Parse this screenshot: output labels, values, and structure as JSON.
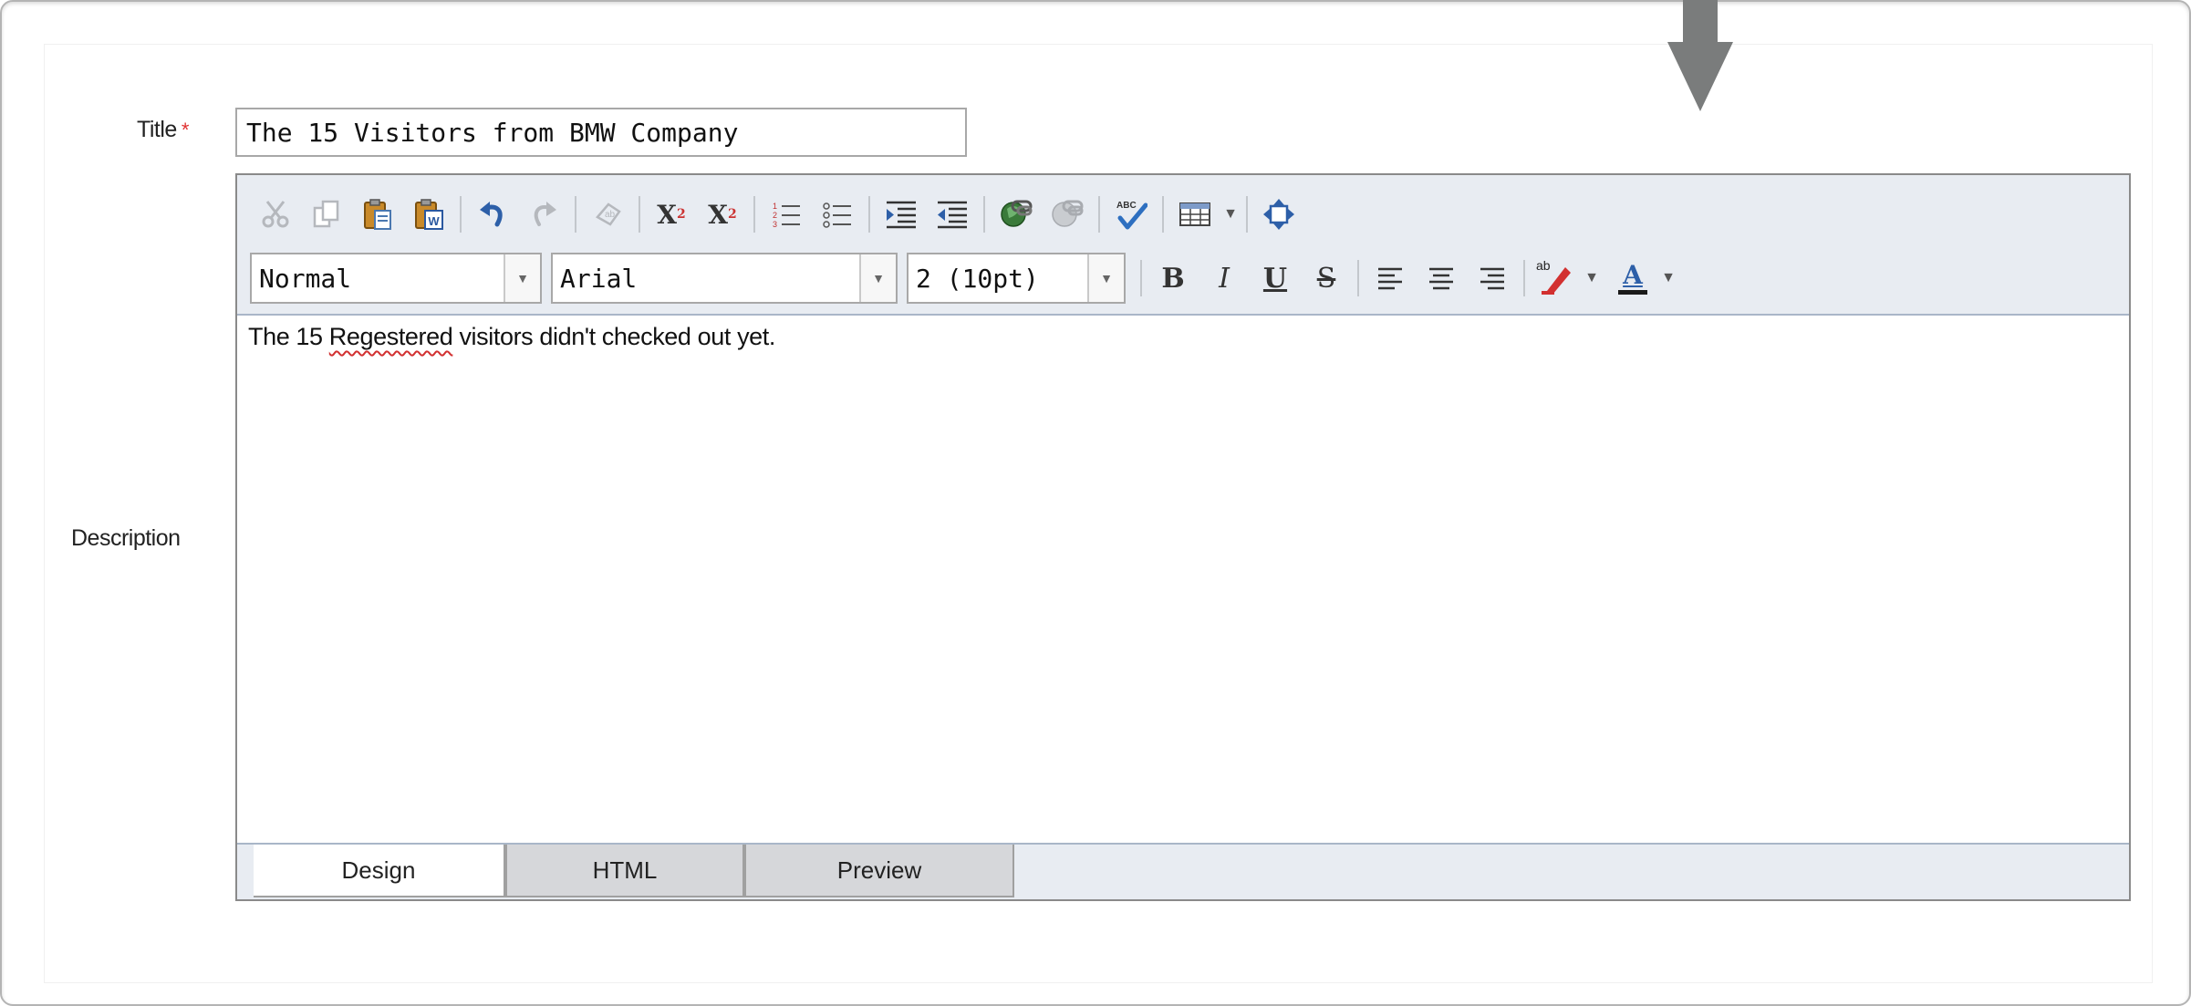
{
  "form": {
    "title_label": "Title",
    "required_mark": "*",
    "title_value": "The 15 Visitors from BMW Company",
    "description_label": "Description"
  },
  "toolbar": {
    "row1": [
      {
        "name": "cut-icon",
        "glyph": "✂",
        "enabled": false
      },
      {
        "name": "copy-icon",
        "glyph": "⎘",
        "enabled": false
      },
      {
        "name": "paste-icon",
        "glyph": "📋",
        "enabled": true
      },
      {
        "name": "paste-from-word-icon",
        "glyph": "W",
        "enabled": true
      },
      {
        "name": "undo-icon",
        "glyph": "↶",
        "enabled": true
      },
      {
        "name": "redo-icon",
        "glyph": "↷",
        "enabled": false
      },
      {
        "name": "remove-format-icon",
        "glyph": "⌫",
        "enabled": false
      },
      {
        "name": "superscript-icon",
        "glyph": "X²",
        "enabled": true
      },
      {
        "name": "subscript-icon",
        "glyph": "X₂",
        "enabled": true
      },
      {
        "name": "ordered-list-icon",
        "glyph": "☰",
        "enabled": true
      },
      {
        "name": "unordered-list-icon",
        "glyph": "☷",
        "enabled": true
      },
      {
        "name": "indent-icon",
        "glyph": "⇥",
        "enabled": true
      },
      {
        "name": "outdent-icon",
        "glyph": "⇤",
        "enabled": true
      },
      {
        "name": "insert-link-icon",
        "glyph": "🔗",
        "enabled": true
      },
      {
        "name": "remove-link-icon",
        "glyph": "⛓",
        "enabled": false
      },
      {
        "name": "spellcheck-icon",
        "glyph": "✔",
        "enabled": true
      },
      {
        "name": "table-icon",
        "glyph": "▦",
        "enabled": true
      },
      {
        "name": "fullscreen-icon",
        "glyph": "⬍",
        "enabled": true
      }
    ],
    "block_format": "Normal",
    "font_name": "Arial",
    "font_size": "2 (10pt)",
    "bold": "B",
    "italic": "I",
    "underline": "U",
    "strike": "S",
    "highlight_label": "ab",
    "font_color_label": "A"
  },
  "colors": {
    "accent_red": "#e03030",
    "font_color_bar": "#1a1a1a",
    "highlight_pen": "#d23030"
  },
  "editor": {
    "content_prefix": "The 15 ",
    "content_misspelled": "Regestered",
    "content_suffix": " visitors didn't checked out yet."
  },
  "tabs": [
    "Design",
    "HTML",
    "Preview"
  ]
}
